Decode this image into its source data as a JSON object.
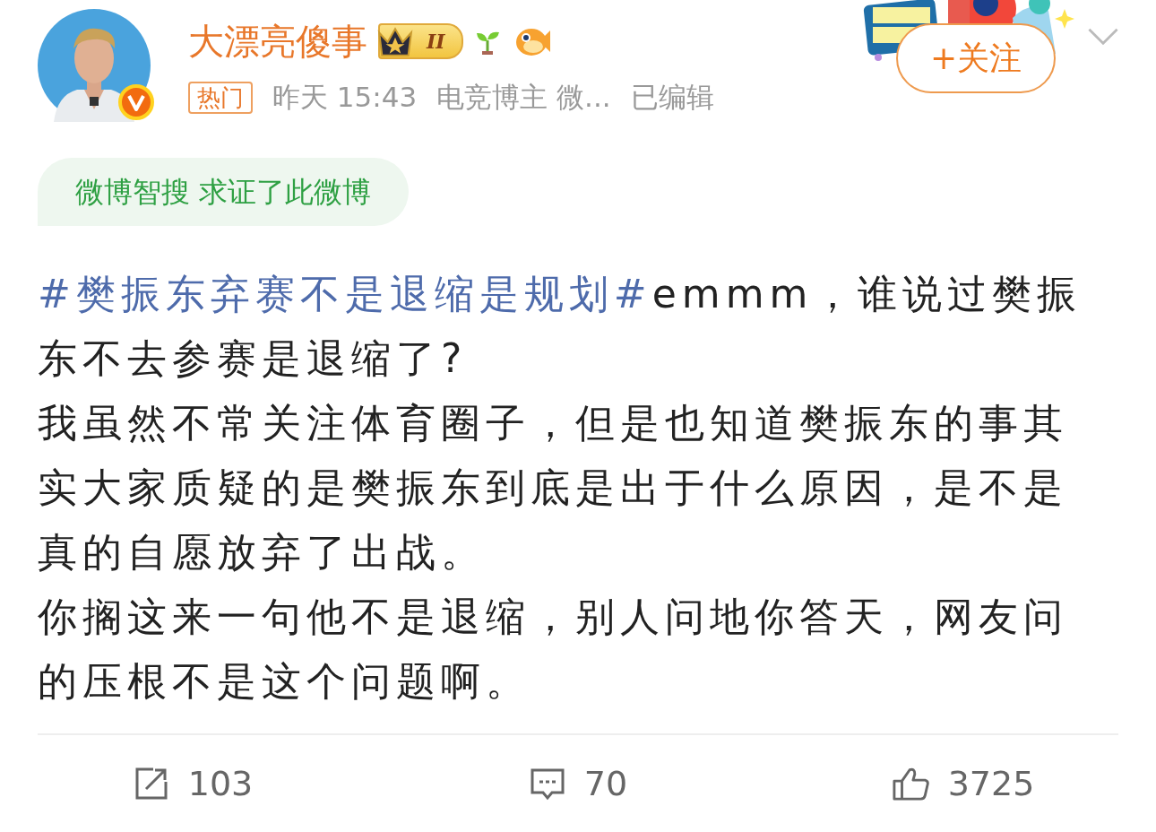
{
  "author": {
    "name": "大漂亮傻事",
    "level": "II",
    "verified": true
  },
  "meta": {
    "tag": "热门",
    "time": "昨天 15:43",
    "source": "电竞博主 微...",
    "edited": "已编辑"
  },
  "follow_button": "+关注",
  "verify_note": "微博智搜 求证了此微博",
  "paragraphs": [
    {
      "topic": "#樊振东弃赛不是退缩是规划#",
      "text": "emmm，谁说过樊振东不去参赛是退缩了?"
    },
    {
      "text": "我虽然不常关注体育圈子，但是也知道樊振东的事其实大家质疑的是樊振东到底是出于什么原因，是不是真的自愿放弃了出战。"
    },
    {
      "text": "你搁这来一句他不是退缩，别人问地你答天，网友问的压根不是这个问题啊。"
    }
  ],
  "actions": [
    {
      "kind": "repost",
      "count": "103"
    },
    {
      "kind": "comment",
      "count": "70"
    },
    {
      "kind": "like",
      "count": "3725"
    }
  ]
}
